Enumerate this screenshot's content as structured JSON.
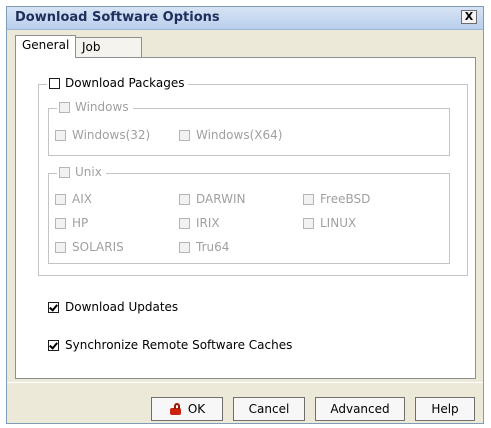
{
  "window": {
    "title": "Download Software Options",
    "close_glyph": "X"
  },
  "tabs": [
    {
      "label": "General",
      "active": true
    },
    {
      "label": "Job Initiation",
      "active": false
    }
  ],
  "download_packages": {
    "label": "Download Packages",
    "checked": false,
    "windows_group": {
      "label": "Windows",
      "options": [
        "Windows(32)",
        "Windows(X64)"
      ]
    },
    "unix_group": {
      "label": "Unix",
      "options": [
        "AIX",
        "DARWIN",
        "FreeBSD",
        "HP",
        "IRIX",
        "LINUX",
        "SOLARIS",
        "Tru64"
      ]
    }
  },
  "download_updates": {
    "label": "Download Updates",
    "checked": true
  },
  "sync_caches": {
    "label": "Synchronize Remote Software Caches",
    "checked": true
  },
  "buttons": {
    "ok": "OK",
    "cancel": "Cancel",
    "advanced": "Advanced",
    "help": "Help"
  }
}
